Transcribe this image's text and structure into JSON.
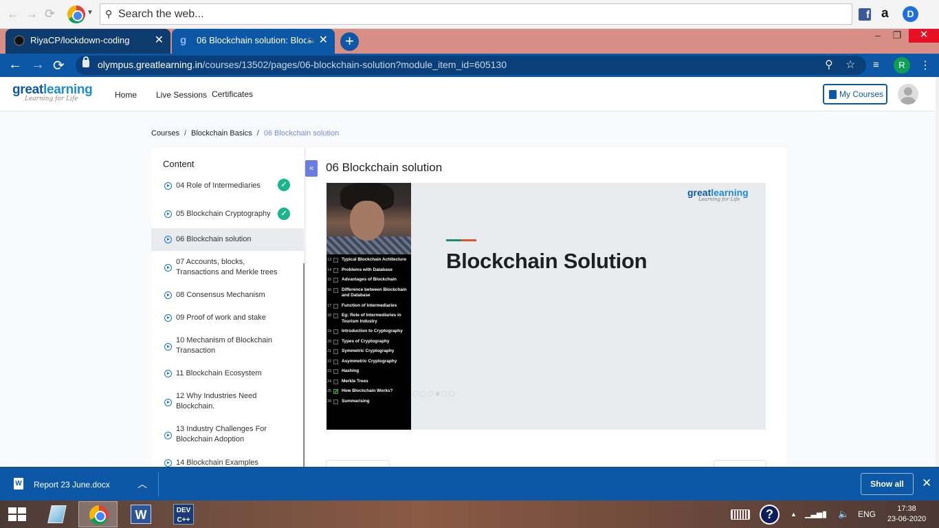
{
  "os_search": {
    "placeholder": "Search the web..."
  },
  "tabs": [
    {
      "title": "RiyaCP/lockdown-coding",
      "close": "✕"
    },
    {
      "title": "06 Blockchain solution: Block",
      "close": "✕"
    }
  ],
  "address": {
    "domain": "olympus.greatlearning.in",
    "path": "/courses/13502/pages/06-blockchain-solution?module_item_id=605130",
    "profile_initial": "R"
  },
  "site": {
    "logo_main": "great",
    "logo_bold": "learning",
    "logo_tag": "Learning for Life",
    "nav": [
      "Home",
      "Live Sessions",
      "Certificates"
    ],
    "my_courses": "My Courses"
  },
  "breadcrumb": [
    "Courses",
    "Blockchain Basics",
    "06 Blockchain solution"
  ],
  "sidebar": {
    "heading": "Content",
    "items": [
      {
        "label": "04 Role of Intermediaries",
        "done": true
      },
      {
        "label": "05 Blockchain Cryptography",
        "done": true
      },
      {
        "label": "06 Blockchain solution",
        "active": true
      },
      {
        "label": "07 Accounts, blocks, Transactions and Merkle trees"
      },
      {
        "label": "08 Consensus Mechanism"
      },
      {
        "label": "09 Proof of work and stake"
      },
      {
        "label": "10 Mechanism of Blockchain Transaction"
      },
      {
        "label": "11 Blockchain Ecosystem"
      },
      {
        "label": "12 Why Industries Need Blockchain."
      },
      {
        "label": "13 Industry Challenges For Blockchain Adoption"
      },
      {
        "label": "14 Blockchain Examples"
      }
    ]
  },
  "page_title": "06 Blockchain solution",
  "video": {
    "slide_title": "Blockchain Solution",
    "logo_main": "great",
    "logo_bold": "learning",
    "logo_tag": "Learning for Life",
    "toc": [
      {
        "n": "13",
        "t": "Typical Blockchain Achitecture"
      },
      {
        "n": "14",
        "t": "Problems with Database"
      },
      {
        "n": "15",
        "t": "Advantages of Blockchain"
      },
      {
        "n": "16",
        "t": "Difference between Blockchain and Database"
      },
      {
        "n": "17",
        "t": "Function of Intermediaries"
      },
      {
        "n": "18",
        "t": "Eg: Role of Intermediaries in Tourism Industry"
      },
      {
        "n": "19",
        "t": "Introduction to Cryptography"
      },
      {
        "n": "20",
        "t": "Types of Cryptography"
      },
      {
        "n": "21",
        "t": "Symmetric Cryptography"
      },
      {
        "n": "22",
        "t": "Asymmetric Cryptography"
      },
      {
        "n": "23",
        "t": "Hashing"
      },
      {
        "n": "24",
        "t": "Merkle Trees"
      },
      {
        "n": "25",
        "t": "How Blockchain Works?",
        "checked": true
      },
      {
        "n": "26",
        "t": "Summarising"
      }
    ]
  },
  "download": {
    "file": "Report 23 June.docx",
    "show_all": "Show all"
  },
  "taskbar": {
    "lang": "ENG",
    "time": "17:38",
    "date": "23-06-2020",
    "dev_label": "DEV"
  }
}
